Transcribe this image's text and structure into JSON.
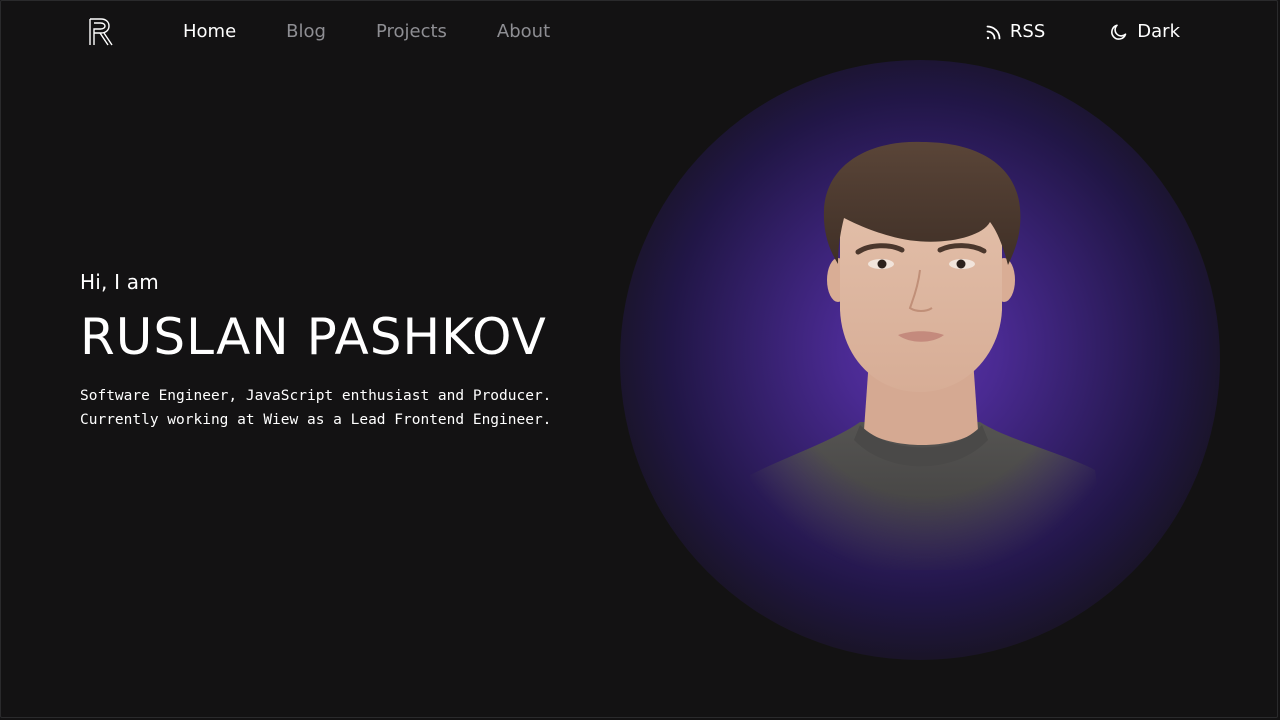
{
  "header": {
    "logo_icon": "r-monogram-logo-icon",
    "nav": [
      {
        "label": "Home",
        "active": true
      },
      {
        "label": "Blog",
        "active": false
      },
      {
        "label": "Projects",
        "active": false
      },
      {
        "label": "About",
        "active": false
      }
    ],
    "rss": {
      "label": "RSS",
      "icon": "rss-icon"
    },
    "theme": {
      "label": "Dark",
      "icon": "moon-icon"
    }
  },
  "hero": {
    "greeting": "Hi, I am",
    "name": "RUSLAN PASHKOV",
    "bio_line_1": "Software Engineer, JavaScript enthusiast and Producer.",
    "bio_line_2": "Currently working at Wiew as a Lead Frontend Engineer."
  },
  "colors": {
    "background": "#131213",
    "text": "#ffffff",
    "nav_inactive": "#8e8e93",
    "glow_accent": "#5a32a8"
  }
}
